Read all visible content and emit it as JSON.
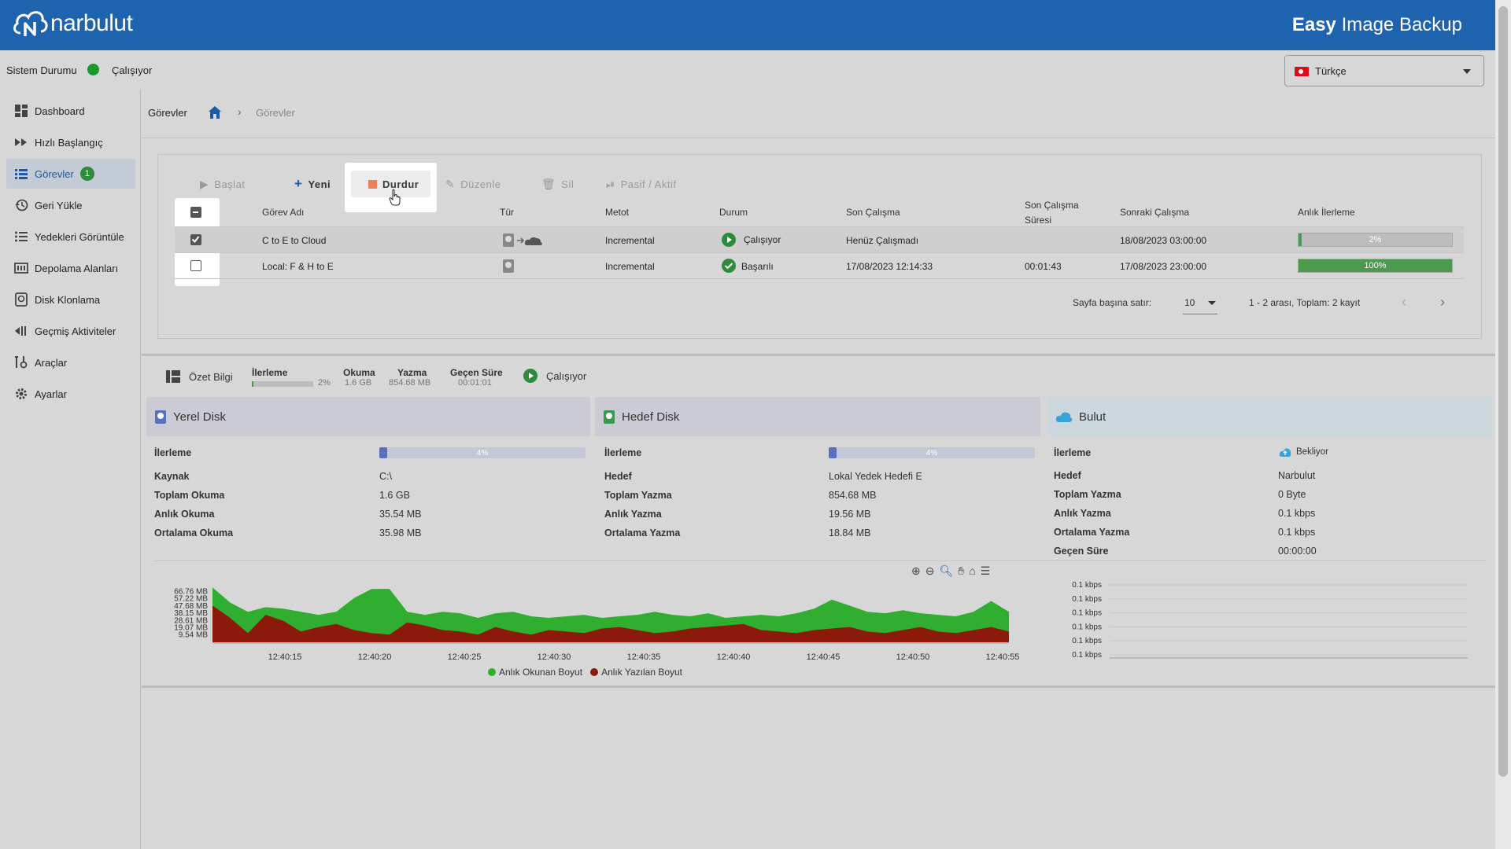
{
  "header": {
    "logo_text": "narbulut",
    "app_title_bold": "Easy",
    "app_title_rest": " Image Backup"
  },
  "status": {
    "label": "Sistem Durumu",
    "state": "Çalışıyor",
    "color": "#1a9a2a"
  },
  "language": {
    "selected": "Türkçe",
    "flag": "turkey-flag"
  },
  "sidebar": {
    "items": [
      {
        "label": "Dashboard",
        "icon": "dashboard-icon"
      },
      {
        "label": "Hızlı Başlangıç",
        "icon": "fast-forward-icon"
      },
      {
        "label": "Görevler",
        "icon": "list-icon",
        "badge": "1",
        "active": true
      },
      {
        "label": "Geri Yükle",
        "icon": "restore-icon"
      },
      {
        "label": "Yedekleri Görüntüle",
        "icon": "view-list-icon"
      },
      {
        "label": "Depolama Alanları",
        "icon": "storage-icon"
      },
      {
        "label": "Disk Klonlama",
        "icon": "disk-icon"
      },
      {
        "label": "Geçmiş Aktiviteler",
        "icon": "history-icon"
      },
      {
        "label": "Araçlar",
        "icon": "tools-icon"
      },
      {
        "label": "Ayarlar",
        "icon": "gear-icon"
      }
    ]
  },
  "breadcrumb": {
    "title": "Görevler",
    "current": "Görevler"
  },
  "toolbar": {
    "start": "Başlat",
    "new": "Yeni",
    "stop": "Durdur",
    "edit": "Düzenle",
    "delete": "Sil",
    "toggle": "Pasif / Aktif"
  },
  "table": {
    "headers": {
      "name": "Görev Adı",
      "type": "Tür",
      "method": "Metot",
      "status": "Durum",
      "last_run": "Son Çalışma",
      "last_duration_1": "Son Çalışma",
      "last_duration_2": "Süresi",
      "next_run": "Sonraki Çalışma",
      "progress": "Anlık İlerleme"
    },
    "rows": [
      {
        "name": "C to E to Cloud",
        "method": "Incremental",
        "status": "Çalışıyor",
        "last_run": "Henüz Çalışmadı",
        "duration": "",
        "next_run": "18/08/2023 03:00:00",
        "progress_label": "2%",
        "progress": 0.02,
        "checked": true
      },
      {
        "name": "Local: F & H to E",
        "method": "Incremental",
        "status": "Başarılı",
        "last_run": "17/08/2023 12:14:33",
        "duration": "00:01:43",
        "next_run": "17/08/2023 23:00:00",
        "progress_label": "100%",
        "progress": 1.0,
        "checked": false
      }
    ]
  },
  "pagination": {
    "rows_label": "Sayfa başına satır:",
    "rows_value": "10",
    "range": "1 - 2 arası, Toplam: 2 kayıt"
  },
  "summary": {
    "title": "Özet Bilgi",
    "progress_label": "İlerleme",
    "progress_value": "2%",
    "progress": 0.02,
    "read_label": "Okuma",
    "read_value": "1.6 GB",
    "write_label": "Yazma",
    "write_value": "854.68 MB",
    "elapsed_label": "Geçen Süre",
    "elapsed_value": "00:01:01",
    "state": "Çalışıyor"
  },
  "local_disk": {
    "title": "Yerel Disk",
    "progress_label": "İlerleme",
    "progress_text": "4%",
    "progress": 0.04,
    "rows": [
      {
        "k": "Kaynak",
        "v": "C:\\"
      },
      {
        "k": "Toplam Okuma",
        "v": "1.6 GB"
      },
      {
        "k": "Anlık Okuma",
        "v": "35.54 MB"
      },
      {
        "k": "Ortalama Okuma",
        "v": "35.98 MB"
      }
    ]
  },
  "target_disk": {
    "title": "Hedef Disk",
    "progress_label": "İlerleme",
    "progress_text": "4%",
    "progress": 0.04,
    "rows": [
      {
        "k": "Hedef",
        "v": "Lokal Yedek Hedefi E"
      },
      {
        "k": "Toplam Yazma",
        "v": "854.68 MB"
      },
      {
        "k": "Anlık Yazma",
        "v": "19.56 MB"
      },
      {
        "k": "Ortalama Yazma",
        "v": "18.84 MB"
      }
    ]
  },
  "cloud": {
    "title": "Bulut",
    "progress_label": "İlerleme",
    "progress_text": "Bekliyor",
    "rows": [
      {
        "k": "Hedef",
        "v": "Narbulut"
      },
      {
        "k": "Toplam Yazma",
        "v": "0 Byte"
      },
      {
        "k": "Anlık Yazma",
        "v": "0.1 kbps"
      },
      {
        "k": "Ortalama Yazma",
        "v": "0.1 kbps"
      },
      {
        "k": "Geçen Süre",
        "v": "00:00:00"
      }
    ]
  },
  "colors": {
    "header": "#1e63ad",
    "read_series": "#2fae2f",
    "write_series": "#8b1a0a",
    "progress_green": "#4c9a4c"
  },
  "chart_data": [
    {
      "type": "area",
      "yticks": [
        "66.76 MB",
        "57.22 MB",
        "47.68 MB",
        "38.15 MB",
        "28.61 MB",
        "19.07 MB",
        "9.54 MB"
      ],
      "xticks": [
        "12:40:15",
        "12:40:20",
        "12:40:25",
        "12:40:30",
        "12:40:35",
        "12:40:40",
        "12:40:45",
        "12:40:50",
        "12:40:55"
      ],
      "ylim": [
        0,
        76.3
      ],
      "series": [
        {
          "name": "Anlık Okunan Boyut",
          "color": "#2fae2f",
          "values": [
            72,
            52,
            40,
            46,
            44,
            40,
            36,
            40,
            58,
            70,
            70,
            40,
            36,
            40,
            38,
            32,
            38,
            40,
            34,
            32,
            34,
            36,
            32,
            34,
            36,
            40,
            36,
            34,
            38,
            32,
            34,
            36,
            34,
            38,
            44,
            56,
            48,
            40,
            38,
            42,
            38,
            36,
            34,
            40,
            54,
            40
          ]
        },
        {
          "name": "Anlık Yazılan Boyut",
          "color": "#8b1a0a",
          "values": [
            48,
            32,
            12,
            36,
            28,
            14,
            20,
            24,
            16,
            12,
            10,
            26,
            22,
            16,
            14,
            10,
            20,
            14,
            10,
            16,
            14,
            12,
            18,
            20,
            16,
            12,
            14,
            18,
            20,
            22,
            24,
            16,
            14,
            12,
            16,
            18,
            20,
            14,
            12,
            16,
            20,
            14,
            12,
            16,
            20,
            14
          ]
        }
      ],
      "legend": "bottom"
    },
    {
      "type": "line",
      "yticks": [
        "0.1 kbps",
        "0.1 kbps",
        "0.1 kbps",
        "0.1 kbps",
        "0.1 kbps",
        "0.1 kbps"
      ],
      "series": []
    }
  ]
}
